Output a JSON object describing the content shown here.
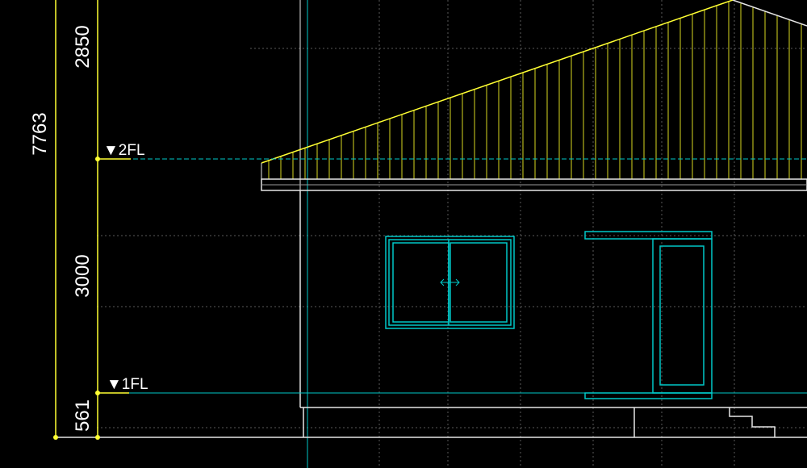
{
  "drawing": {
    "dimensions": {
      "total": "7763",
      "upper": "2850",
      "middle": "3000",
      "lower": "561"
    },
    "levels": {
      "second_floor": "▼2FL",
      "first_floor": "▼1FL"
    },
    "colors": {
      "background": "#000000",
      "outline": "#ffffff",
      "dimension": "#ffff33",
      "openings": "#00c8c8",
      "grid": "#5a5a5a",
      "roof_hatch": "#e0e020"
    }
  }
}
